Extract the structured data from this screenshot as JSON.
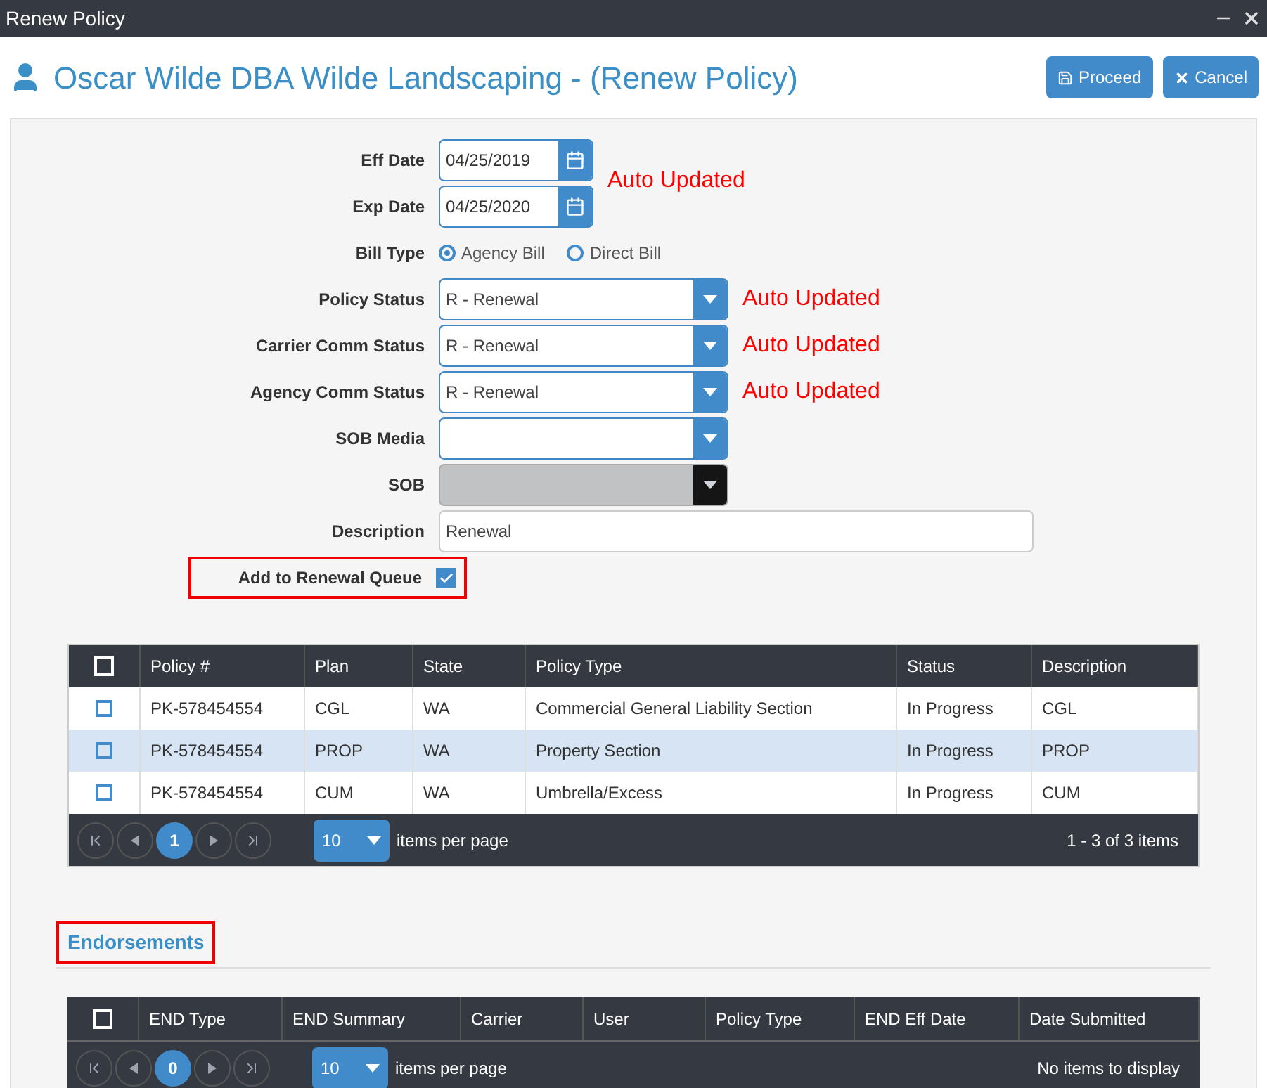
{
  "window": {
    "title": "Renew Policy"
  },
  "header": {
    "title": "Oscar Wilde DBA Wilde Landscaping - (Renew Policy)",
    "buttons": [
      {
        "kind": "save",
        "label": "Proceed"
      },
      {
        "kind": "cancel",
        "label": "Cancel"
      }
    ]
  },
  "form": [
    {
      "kind": "date",
      "label": "Eff Date",
      "value": "04/25/2019",
      "note": "Auto Updated"
    },
    {
      "kind": "date",
      "label": "Exp Date",
      "value": "04/25/2020"
    },
    {
      "kind": "radio",
      "label": "Bill Type",
      "options": [
        {
          "label": "Agency Bill",
          "selected": true
        },
        {
          "label": "Direct Bill",
          "selected": false
        }
      ]
    },
    {
      "kind": "select",
      "label": "Policy Status",
      "value": "R - Renewal",
      "disabled": false,
      "note": "Auto Updated"
    },
    {
      "kind": "select",
      "label": "Carrier Comm Status",
      "value": "R - Renewal",
      "disabled": false,
      "note": "Auto Updated"
    },
    {
      "kind": "select",
      "label": "Agency Comm Status",
      "value": "R - Renewal",
      "disabled": false,
      "note": "Auto Updated"
    },
    {
      "kind": "select",
      "label": "SOB Media",
      "disabled": false
    },
    {
      "kind": "select",
      "label": "SOB",
      "disabled": true
    },
    {
      "kind": "text",
      "label": "Description",
      "value": "Renewal"
    },
    {
      "kind": "checkbox",
      "label": "Add to Renewal Queue",
      "checked": true,
      "highlighted": true
    }
  ],
  "policies_table": {
    "select_all_checked": false,
    "columns": [
      "Policy #",
      "Plan",
      "State",
      "Policy Type",
      "Status",
      "Description"
    ],
    "rows": [
      {
        "selected": false,
        "checked": false,
        "cells": [
          "PK-578454554",
          "CGL",
          "WA",
          "Commercial General Liability Section",
          "In Progress",
          "CGL"
        ]
      },
      {
        "selected": true,
        "checked": false,
        "cells": [
          "PK-578454554",
          "PROP",
          "WA",
          "Property Section",
          "In Progress",
          "PROP"
        ]
      },
      {
        "selected": false,
        "checked": false,
        "cells": [
          "PK-578454554",
          "CUM",
          "WA",
          "Umbrella/Excess",
          "In Progress",
          "CUM"
        ]
      }
    ],
    "pager": {
      "page": "1",
      "page_size": "10",
      "page_size_label": "items per page",
      "summary": "1 - 3 of 3 items"
    }
  },
  "endorsements": {
    "heading": "Endorsements",
    "highlighted": true,
    "select_all_checked": false,
    "columns": [
      "END Type",
      "END Summary",
      "Carrier",
      "User",
      "Policy Type",
      "END Eff Date",
      "Date Submitted"
    ],
    "pager": {
      "page": "0",
      "page_size": "10",
      "page_size_label": "items per page",
      "summary": "No items to display"
    }
  }
}
